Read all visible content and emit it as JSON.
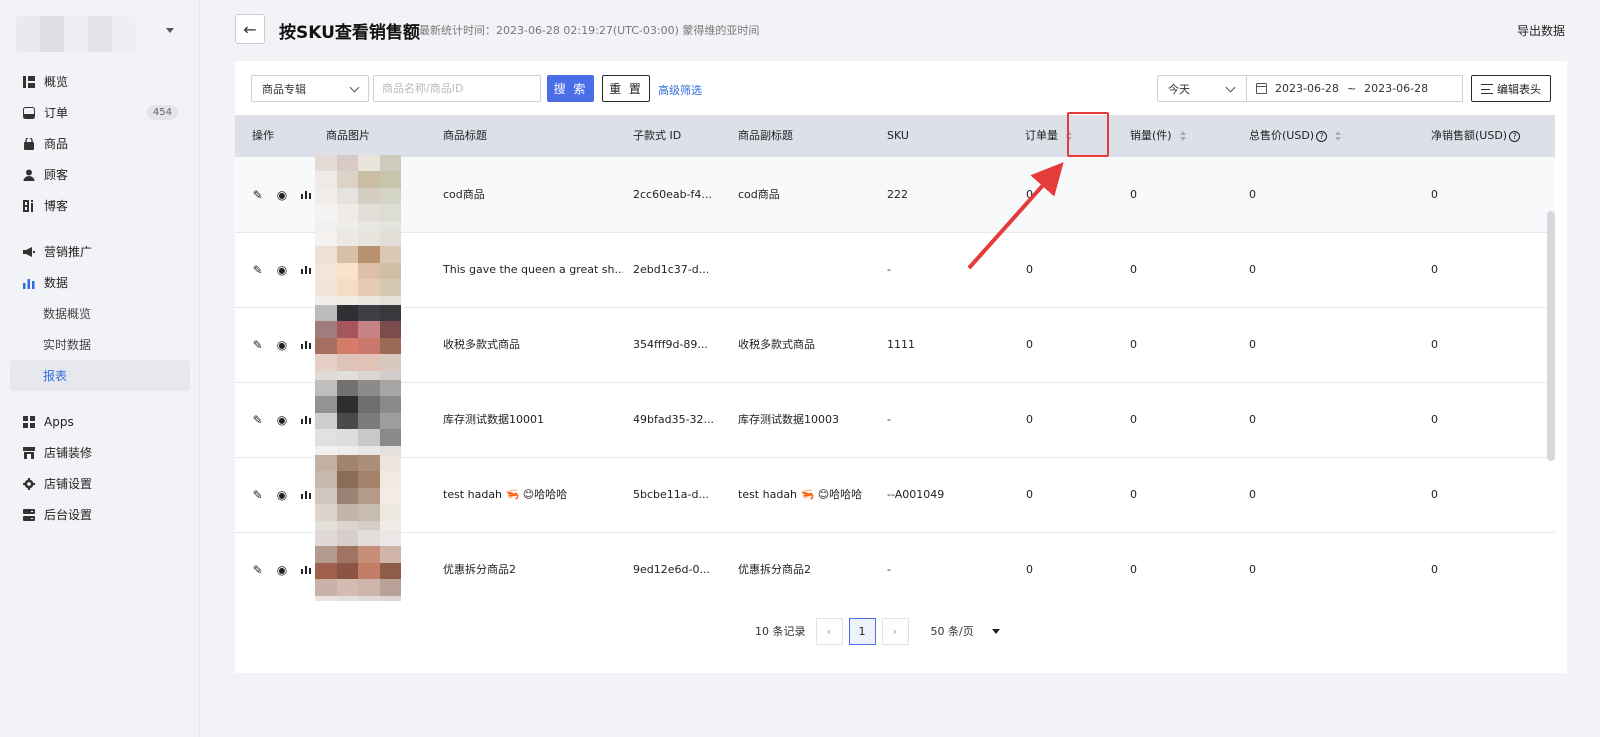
{
  "sidebar": {
    "store_caret_icon": "chevron-down-icon",
    "items": [
      {
        "icon": "overview-icon",
        "label": "概览"
      },
      {
        "icon": "order-icon",
        "label": "订单",
        "badge": "454"
      },
      {
        "icon": "product-icon",
        "label": "商品"
      },
      {
        "icon": "customer-icon",
        "label": "顾客"
      },
      {
        "icon": "blog-icon",
        "label": "博客"
      },
      {
        "icon": "marketing-icon",
        "label": "营销推广"
      },
      {
        "icon": "data-icon",
        "label": "数据"
      },
      {
        "icon": "apps-icon",
        "label": "Apps"
      },
      {
        "icon": "store-decor-icon",
        "label": "店铺装修"
      },
      {
        "icon": "store-settings-icon",
        "label": "店铺设置"
      },
      {
        "icon": "admin-settings-icon",
        "label": "后台设置"
      }
    ],
    "data_sub": [
      {
        "label": "数据概览",
        "active": false
      },
      {
        "label": "实时数据",
        "active": false
      },
      {
        "label": "报表",
        "active": true
      }
    ],
    "active_color": "#2f6fe0"
  },
  "header": {
    "title": "按SKU查看销售额",
    "stat_time": "最新统计时间：2023-06-28 02:19:27(UTC-03:00) 蒙得维的亚时间",
    "export_label": "导出数据"
  },
  "toolbar": {
    "filter_select": "商品专辑",
    "search_placeholder": "商品名称/商品ID",
    "search_label": "搜 索",
    "reset_label": "重 置",
    "advanced_label": "高级筛选",
    "date_range_select": "今天",
    "date_from": "2023-06-28",
    "date_sep": "~",
    "date_to": "2023-06-28",
    "edit_header_label": "编辑表头",
    "primary_color": "#4a6ee8"
  },
  "table": {
    "columns": {
      "actions": "操作",
      "image": "商品图片",
      "title": "商品标题",
      "variant_id": "子款式 ID",
      "subtitle": "商品副标题",
      "sku": "SKU",
      "orders": "订单量",
      "quantity": "销量(件)",
      "gross": "总售价(USD)",
      "net": "净销售额(USD)"
    },
    "rows": [
      {
        "title": "cod商品",
        "variant_id": "2cc60eab-f4...",
        "subtitle": "cod商品",
        "sku": "222",
        "orders": "0",
        "quantity": "0",
        "gross": "0",
        "net": "0"
      },
      {
        "title": "This gave the queen a great sh...",
        "variant_id": "2ebd1c37-d...",
        "subtitle": "",
        "sku": "-",
        "orders": "0",
        "quantity": "0",
        "gross": "0",
        "net": "0"
      },
      {
        "title": "收税多款式商品",
        "variant_id": "354fff9d-89...",
        "subtitle": "收税多款式商品",
        "sku": "1111",
        "orders": "0",
        "quantity": "0",
        "gross": "0",
        "net": "0"
      },
      {
        "title": "库存测试数据10001",
        "variant_id": "49bfad35-32...",
        "subtitle": "库存测试数据10003",
        "sku": "-",
        "orders": "0",
        "quantity": "0",
        "gross": "0",
        "net": "0"
      },
      {
        "title": "test hadah 🦐 😊哈哈哈",
        "variant_id": "5bcbe11a-d...",
        "subtitle": "test hadah 🦐 😊哈哈哈",
        "sku": "--A001049",
        "orders": "0",
        "quantity": "0",
        "gross": "0",
        "net": "0"
      },
      {
        "title": "优惠拆分商品2",
        "variant_id": "9ed12e6d-0...",
        "subtitle": "优惠拆分商品2",
        "sku": "-",
        "orders": "0",
        "quantity": "0",
        "gross": "0",
        "net": "0"
      }
    ]
  },
  "pagination": {
    "total": "10 条记录",
    "current_page": "1",
    "page_size": "50 条/页"
  },
  "annotation": {
    "highlight_color": "#e53b3b"
  }
}
